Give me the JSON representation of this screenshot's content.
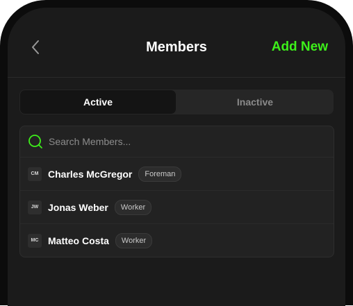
{
  "header": {
    "title": "Members",
    "add_label": "Add New",
    "back_icon": "chevron-left-icon"
  },
  "tabs": [
    {
      "label": "Active",
      "selected": true
    },
    {
      "label": "Inactive",
      "selected": false
    }
  ],
  "search": {
    "placeholder": "Search Members...",
    "value": ""
  },
  "members": [
    {
      "initials": "CM",
      "name": "Charles McGregor",
      "role": "Foreman"
    },
    {
      "initials": "JW",
      "name": "Jonas Weber",
      "role": "Worker"
    },
    {
      "initials": "MC",
      "name": "Matteo Costa",
      "role": "Worker"
    }
  ],
  "colors": {
    "accent": "#3df01a",
    "background": "#1b1b1b",
    "card": "#222222"
  }
}
